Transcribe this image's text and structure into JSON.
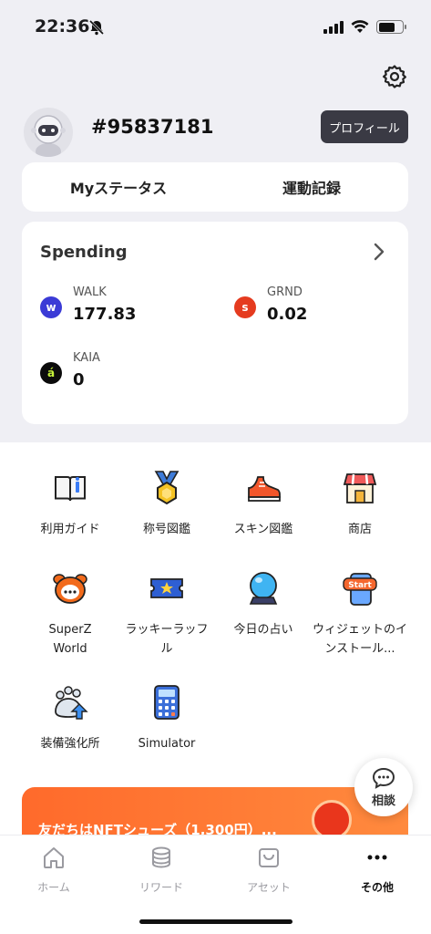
{
  "status": {
    "time": "22:36"
  },
  "profile": {
    "user_id": "#95837181",
    "profile_button": "プロフィール"
  },
  "tabs": [
    "Myステータス",
    "運動記録"
  ],
  "spending": {
    "title": "Spending",
    "tokens": [
      {
        "symbol": "WALK",
        "value": "177.83",
        "color": "#3b3bd6",
        "glyph": "w"
      },
      {
        "symbol": "GRND",
        "value": "0.02",
        "color": "#e53b1f",
        "glyph": "s"
      },
      {
        "symbol": "KAIA",
        "value": "0",
        "color": "#0b0b0b",
        "glyph": "á"
      }
    ]
  },
  "menu": [
    {
      "label": "利用ガイド",
      "icon": "guide-book-icon"
    },
    {
      "label": "称号図鑑",
      "icon": "medal-icon"
    },
    {
      "label": "スキン図鑑",
      "icon": "sneaker-icon"
    },
    {
      "label": "商店",
      "icon": "shop-icon"
    },
    {
      "label": "SuperZ World",
      "icon": "superz-character-icon"
    },
    {
      "label": "ラッキーラッフル",
      "icon": "ticket-icon"
    },
    {
      "label": "今日の占い",
      "icon": "crystal-ball-icon"
    },
    {
      "label": "ウィジェットのインストール...",
      "icon": "widget-phone-icon"
    },
    {
      "label": "装備強化所",
      "icon": "upgrade-paw-icon"
    },
    {
      "label": "Simulator",
      "icon": "calculator-icon"
    }
  ],
  "chat": {
    "label": "相談"
  },
  "banner": {
    "text": "友だちはNFTシューズ（1,300円）..."
  },
  "bottom_nav": [
    {
      "label": "ホーム",
      "icon": "home-icon"
    },
    {
      "label": "リワード",
      "icon": "coins-icon"
    },
    {
      "label": "アセット",
      "icon": "bag-icon"
    },
    {
      "label": "その他",
      "icon": "more-icon"
    }
  ]
}
